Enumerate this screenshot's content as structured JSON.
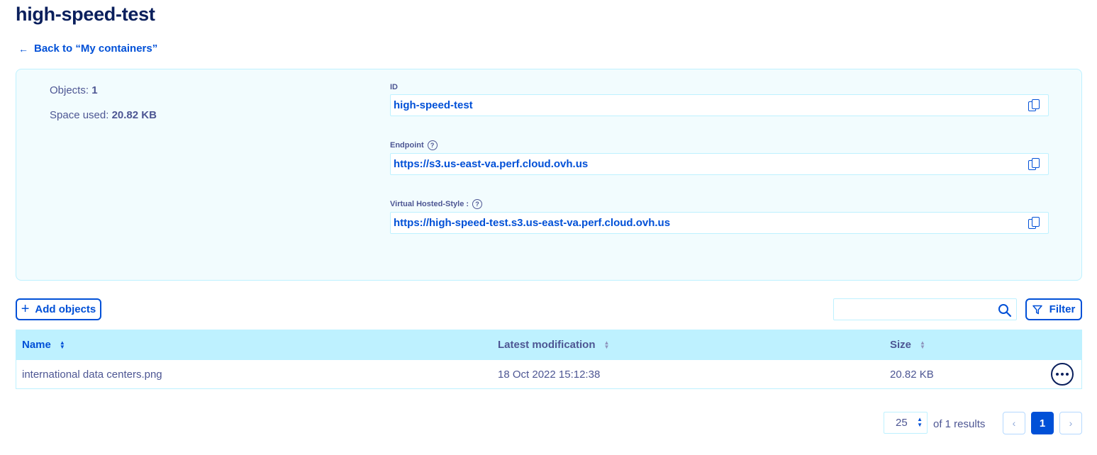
{
  "page": {
    "title": "high-speed-test",
    "back_link": "Back to “My containers”"
  },
  "summary": {
    "objects_label": "Objects:",
    "objects_value": "1",
    "space_label": "Space used:",
    "space_value": "20.82 KB"
  },
  "fields": {
    "id": {
      "label": "ID",
      "value": "high-speed-test"
    },
    "endpoint": {
      "label": "Endpoint",
      "value": "https://s3.us-east-va.perf.cloud.ovh.us"
    },
    "virtual_hosted": {
      "label": "Virtual Hosted-Style :",
      "value": "https://high-speed-test.s3.us-east-va.perf.cloud.ovh.us"
    }
  },
  "toolbar": {
    "add_objects_label": "Add objects",
    "search_placeholder": "",
    "filter_label": "Filter"
  },
  "table": {
    "columns": {
      "name": "Name",
      "modified": "Latest modification",
      "size": "Size"
    },
    "rows": [
      {
        "name": "international data centers.png",
        "modified": "18 Oct 2022 15:12:38",
        "size": "20.82 KB"
      }
    ]
  },
  "pagination": {
    "page_size": "25",
    "results_text": "of 1 results",
    "current_page": "1",
    "prev_icon": "chevron-left-icon",
    "next_icon": "chevron-right-icon"
  },
  "colors": {
    "primary": "#0050d7",
    "title": "#0a1f5c",
    "text": "#4d5693",
    "panel_bg": "#f2fcfe",
    "border": "#bef1ff",
    "table_header_bg": "#bef1ff"
  }
}
